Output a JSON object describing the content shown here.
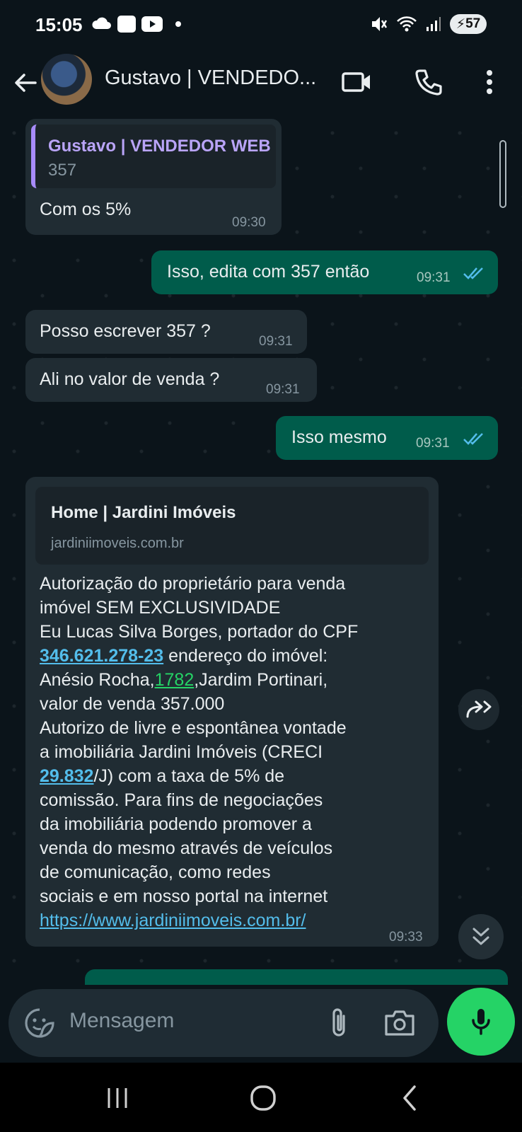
{
  "status_bar": {
    "time": "15:05",
    "battery": "57"
  },
  "header": {
    "contact_name": "Gustavo | VENDEDO...",
    "icons": [
      "back-arrow-icon",
      "video-call-icon",
      "voice-call-icon",
      "more-options-icon"
    ]
  },
  "messages": [
    {
      "direction": "in",
      "quoted": {
        "author": "Gustavo | VENDEDOR WEB",
        "text": "357"
      },
      "text": "Com os 5%",
      "time": "09:30"
    },
    {
      "direction": "out",
      "text": "Isso, edita com 357 então",
      "time": "09:31",
      "status": "read"
    },
    {
      "direction": "in",
      "text": "Posso escrever 357 ?",
      "time": "09:31"
    },
    {
      "direction": "in",
      "text": "Ali no valor de venda ?",
      "time": "09:31"
    },
    {
      "direction": "out",
      "text": "Isso mesmo",
      "time": "09:31",
      "status": "read"
    },
    {
      "direction": "in",
      "link_preview": {
        "title": "Home | Jardini Imóveis",
        "domain": "jardiniimoveis.com.br"
      },
      "lines": {
        "l1": "Autorização do proprietário para venda",
        "l2": "imóvel SEM EXCLUSIVIDADE",
        "l3": "Eu Lucas Silva Borges, portador do CPF",
        "l4_link": "346.621.278-23",
        "l4_rest": " endereço do imóvel:",
        "l5_pre": "Anésio Rocha,",
        "l5_link": "1782",
        "l5_rest": ",Jardim Portinari,",
        "l6": "valor de venda 357.000",
        "l7": "Autorizo de livre e espontânea vontade",
        "l8": "a imobiliária Jardini Imóveis (CRECI",
        "l9_link": "29.832",
        "l9_rest": "/J) com a taxa de 5% de",
        "l10": "comissão. Para fins de negociações",
        "l11": "da imobiliária podendo promover a",
        "l12": "venda do mesmo através de veículos",
        "l13": "de comunicação, como redes",
        "l14": "sociais e em nosso portal na internet",
        "l15_link": "https://www.jardiniimoveis.com.br/"
      },
      "time": "09:33"
    }
  ],
  "input": {
    "placeholder": "Mensagem"
  },
  "colors": {
    "background": "#0b141a",
    "incoming_bubble": "#202c33",
    "outgoing_bubble": "#005c4b",
    "accent": "#25d366",
    "link": "#53bdeb",
    "read_ticks": "#53bdeb"
  }
}
